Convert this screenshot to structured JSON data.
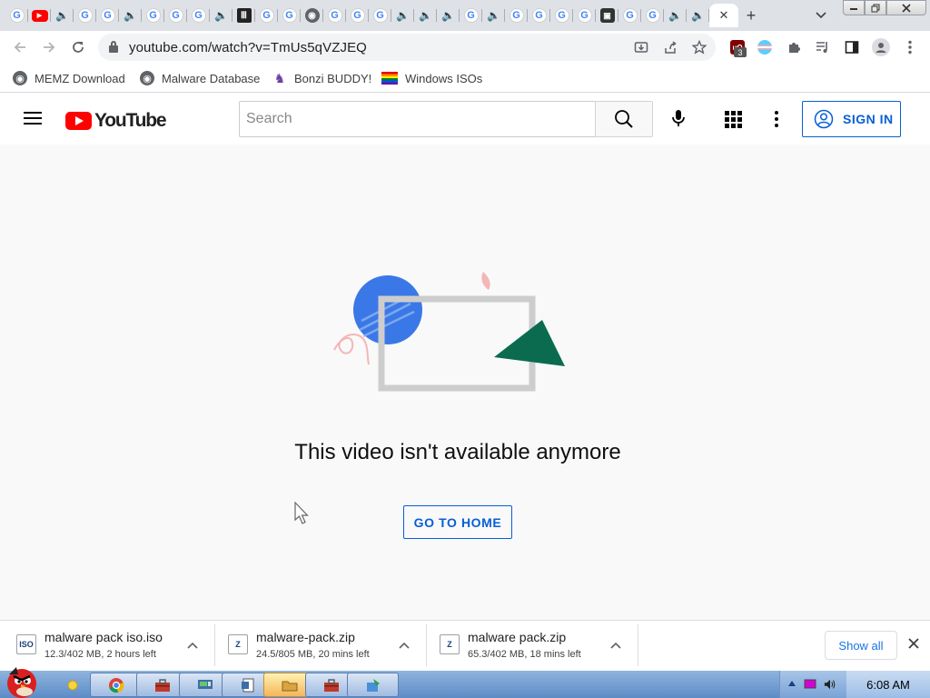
{
  "window": {
    "tabs": [
      {
        "icon": "google-icon"
      },
      {
        "icon": "youtube-icon"
      },
      {
        "icon": "audio-icon"
      },
      {
        "icon": "google-icon"
      },
      {
        "icon": "google-icon"
      },
      {
        "icon": "audio-icon"
      },
      {
        "icon": "google-icon"
      },
      {
        "icon": "google-icon"
      },
      {
        "icon": "google-icon"
      },
      {
        "icon": "audio-icon"
      },
      {
        "icon": "archive-icon"
      },
      {
        "icon": "google-icon"
      },
      {
        "icon": "google-icon"
      },
      {
        "icon": "globe-icon"
      },
      {
        "icon": "google-icon"
      },
      {
        "icon": "google-icon"
      },
      {
        "icon": "google-icon"
      },
      {
        "icon": "audio-icon"
      },
      {
        "icon": "audio-icon"
      },
      {
        "icon": "audio-icon"
      },
      {
        "icon": "google-icon"
      },
      {
        "icon": "audio-icon"
      },
      {
        "icon": "google-icon"
      },
      {
        "icon": "google-icon"
      },
      {
        "icon": "google-icon"
      },
      {
        "icon": "google-icon"
      },
      {
        "icon": "robot-icon"
      },
      {
        "icon": "google-icon"
      },
      {
        "icon": "google-icon"
      },
      {
        "icon": "audio-icon"
      },
      {
        "icon": "audio-icon"
      }
    ],
    "active_tab_close": "✕",
    "new_tab": "+",
    "tab_search": "⌄"
  },
  "toolbar": {
    "url": "youtube.com/watch?v=TmUs5qVZJEQ",
    "ublock_badge": "3"
  },
  "bookmarks": [
    {
      "label": "MEMZ Download",
      "icon": "globe-icon"
    },
    {
      "label": "Malware Database",
      "icon": "globe-icon"
    },
    {
      "label": "Bonzi BUDDY!",
      "icon": "bonzi-icon"
    },
    {
      "label": "Windows ISOs",
      "icon": "rainbow-flag-icon"
    }
  ],
  "youtube": {
    "logo_text": "YouTube",
    "search_placeholder": "Search",
    "sign_in_label": "SIGN IN",
    "error_message": "This video isn't available anymore",
    "home_button_label": "GO TO HOME"
  },
  "downloads": {
    "items": [
      {
        "icon_text": "ISO",
        "name": "malware pack iso.iso",
        "status": "12.3/402 MB, 2 hours left"
      },
      {
        "icon_text": "Z",
        "name": "malware-pack.zip",
        "status": "24.5/805 MB, 20 mins left"
      },
      {
        "icon_text": "Z",
        "name": "malware pack.zip",
        "status": "65.3/402 MB, 18 mins left"
      }
    ],
    "show_all_label": "Show all"
  },
  "taskbar": {
    "time": "6:08 AM"
  },
  "colors": {
    "youtube_red": "#ff0000",
    "link_blue": "#065fd4",
    "illustration_blue": "#3b78e7",
    "illustration_green": "#0b6b4f",
    "illustration_pink": "#f4b6b6"
  }
}
